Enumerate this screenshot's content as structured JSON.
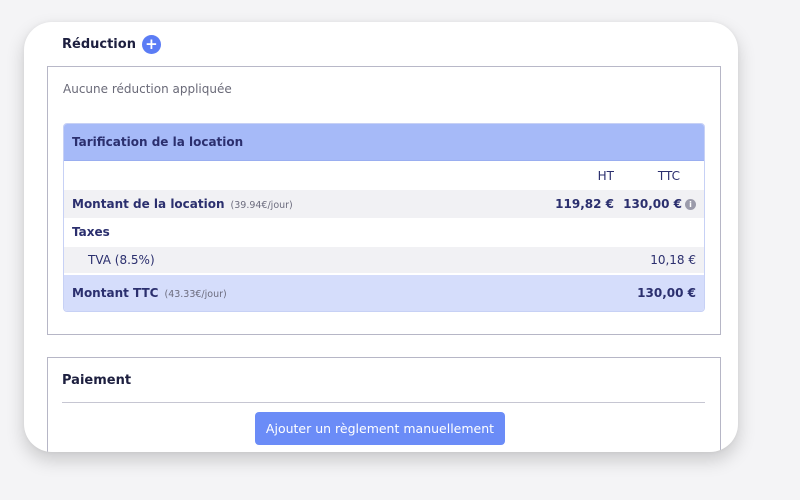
{
  "reduction": {
    "title": "Réduction",
    "add_icon": "plus-icon",
    "empty_text": "Aucune réduction appliquée"
  },
  "pricing": {
    "title": "Tarification de la location",
    "col_ht": "HT",
    "col_ttc": "TTC",
    "rows": [
      {
        "label": "Montant de la location",
        "sub": "(39.94€/jour)",
        "ht": "119,82 €",
        "ttc": "130,00 €",
        "icon": "info-icon"
      },
      {
        "label": "Taxes"
      },
      {
        "label": "TVA (8.5%)",
        "ttc": "10,18 €"
      },
      {
        "label": "Montant TTC",
        "sub": "(43.33€/jour)",
        "ttc": "130,00 €"
      }
    ]
  },
  "payment": {
    "title": "Paiement",
    "add_button": "Ajouter un règlement manuellement"
  },
  "colors": {
    "accent": "#6b8cf7",
    "table_header": "#a6baf8",
    "total_row": "#d5ddfb"
  }
}
